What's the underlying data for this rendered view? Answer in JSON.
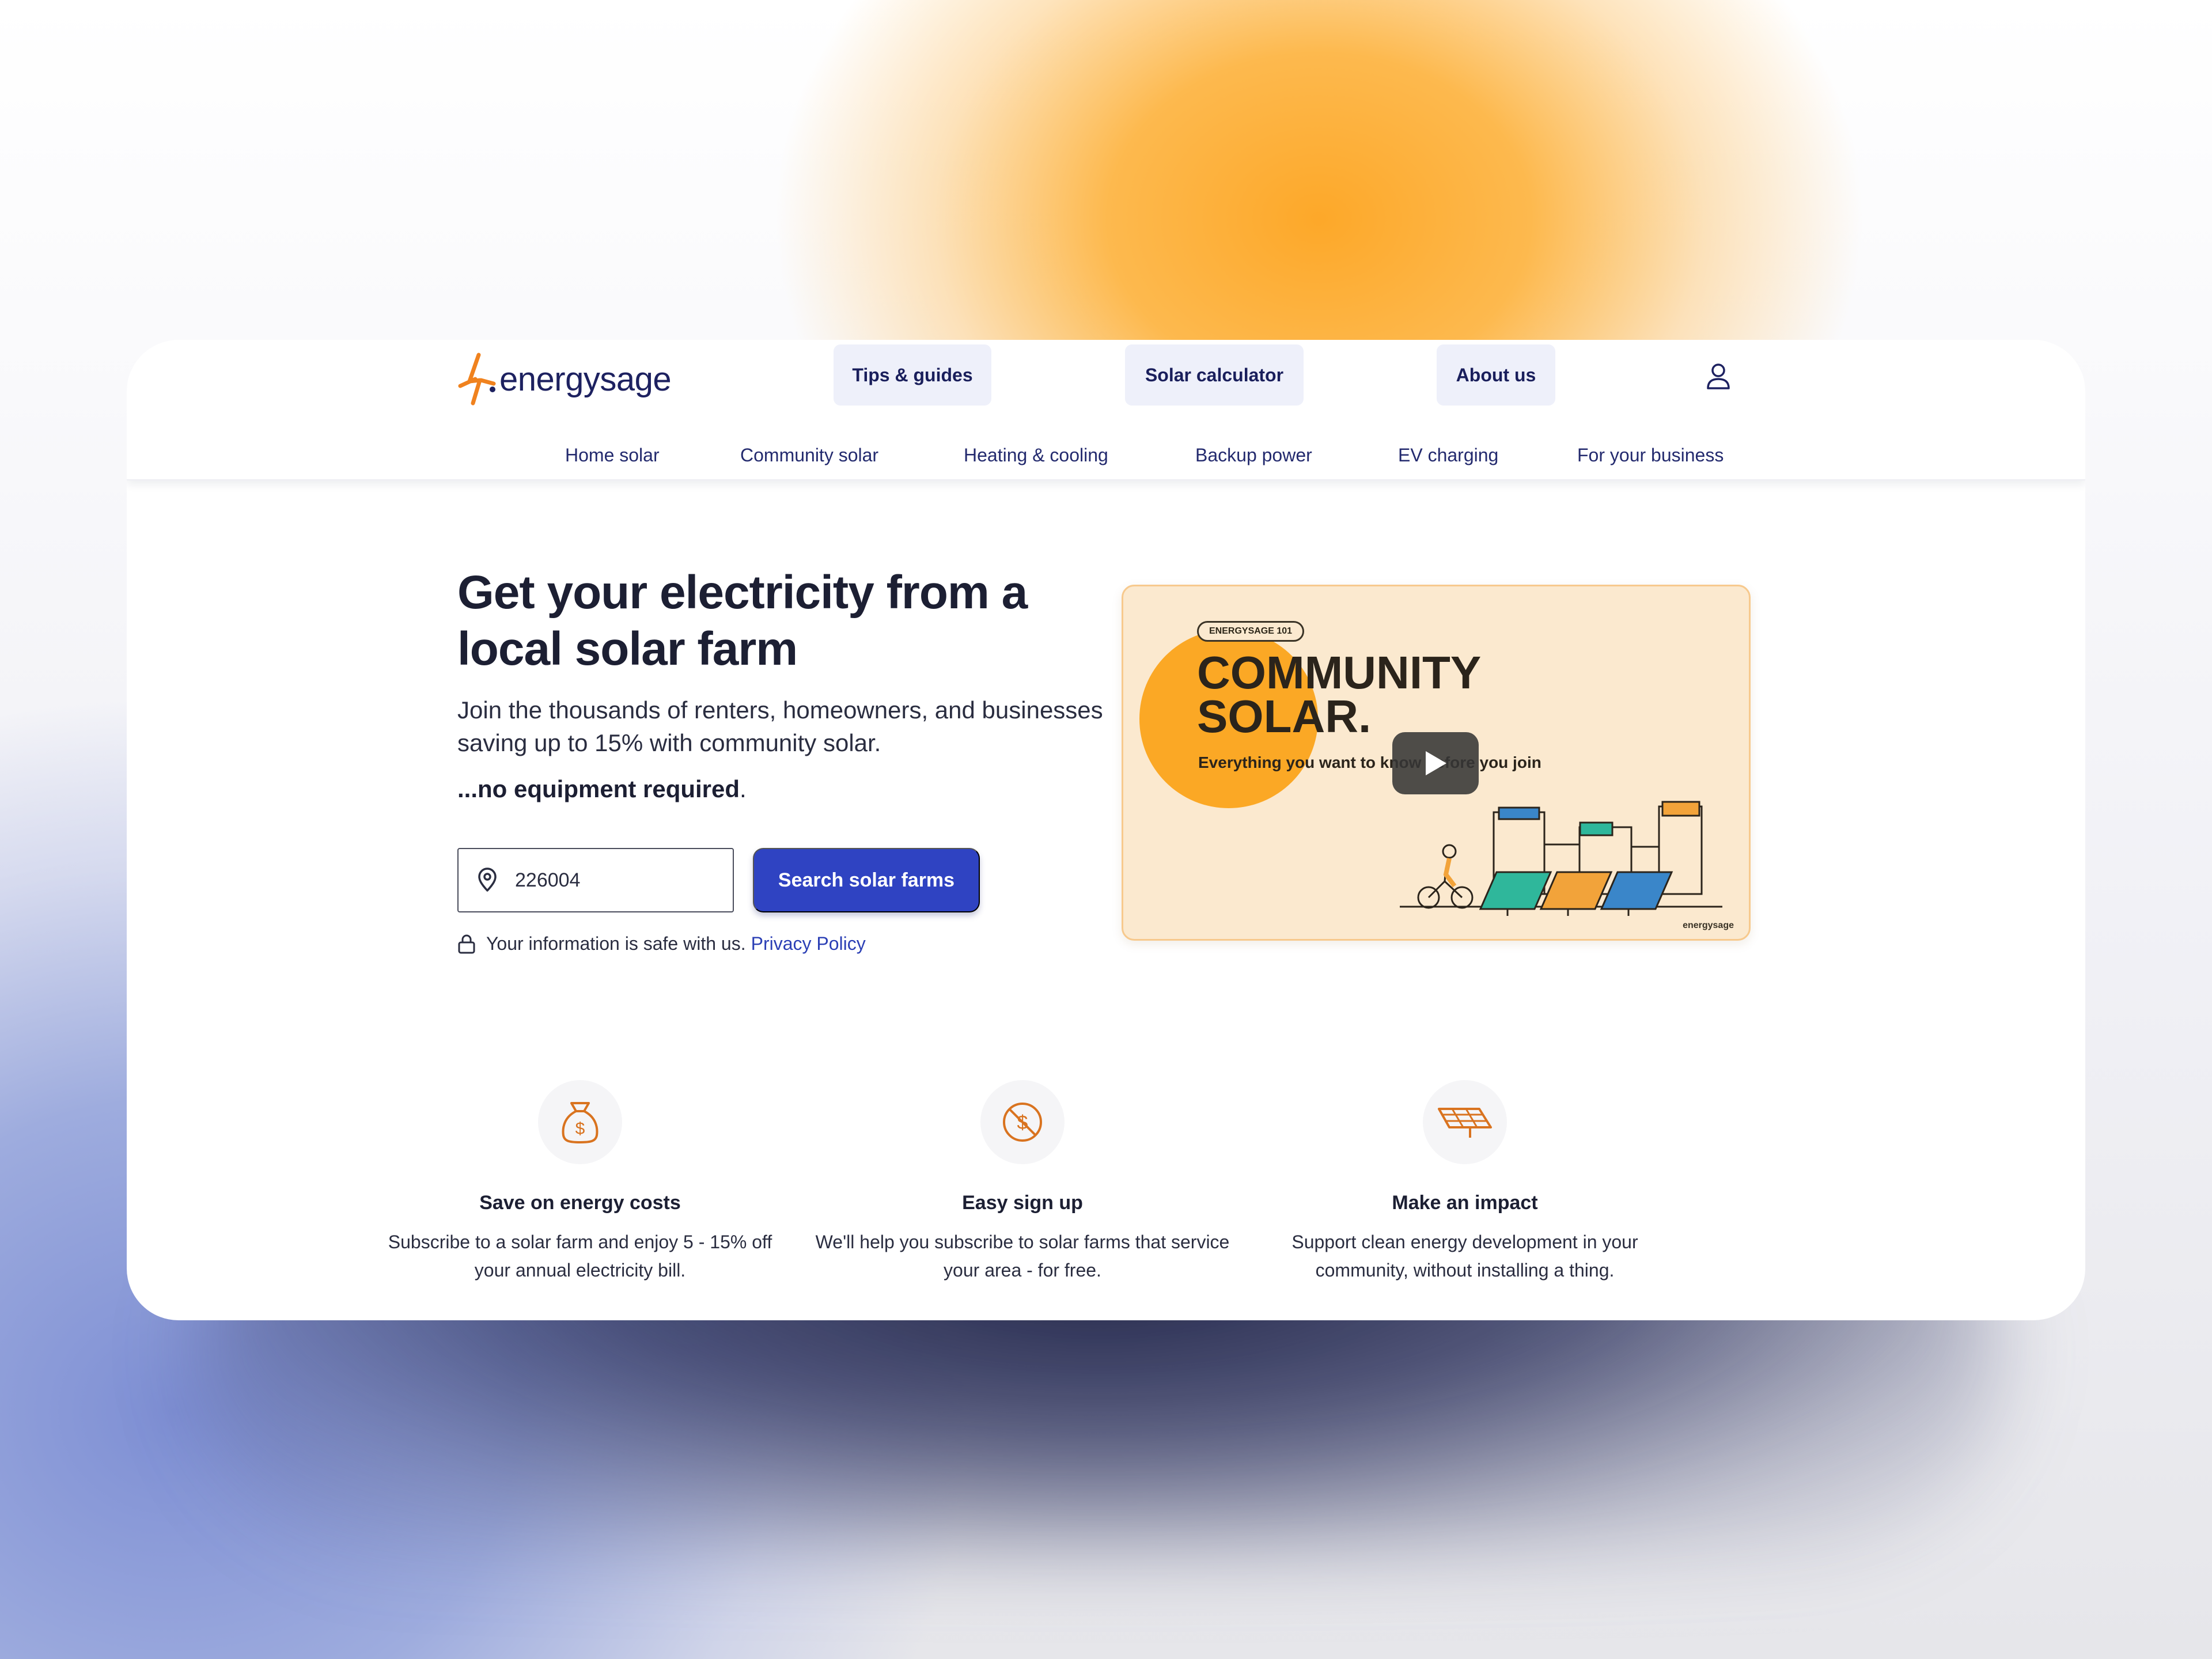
{
  "brand": {
    "name": "energysage",
    "accent": "#f0821e",
    "primary": "#2f43c2",
    "navy": "#1d2160"
  },
  "header": {
    "main_nav": [
      {
        "label": "Tips & guides"
      },
      {
        "label": "Solar calculator"
      },
      {
        "label": "About us"
      }
    ],
    "account_icon": "user-icon",
    "sub_nav": [
      {
        "label": "Home solar"
      },
      {
        "label": "Community solar"
      },
      {
        "label": "Heating & cooling"
      },
      {
        "label": "Backup power"
      },
      {
        "label": "EV charging"
      },
      {
        "label": "For your business"
      }
    ]
  },
  "hero": {
    "title": "Get your electricity from a local solar farm",
    "lead": "Join the thousands of renters, homeowners, and businesses saving up to 15% with community solar.",
    "note_bold": "...no equipment required",
    "note_end": ".",
    "zip_value": "226004",
    "search_label": "Search solar farms",
    "privacy_text": "Your information is safe with us.",
    "privacy_link": "Privacy Policy"
  },
  "video": {
    "badge": "ENERGYSAGE 101",
    "title_line1": "COMMUNITY",
    "title_line2": "SOLAR.",
    "subtitle": "Everything you want to know before you join",
    "brand": "energysage",
    "play_icon": "play-icon"
  },
  "features": [
    {
      "icon": "money-bag-icon",
      "title": "Save on energy costs",
      "text": "Subscribe to a solar farm and enjoy 5 - 15% off your annual electricity bill."
    },
    {
      "icon": "no-fee-icon",
      "title": "Easy sign up",
      "text": "We'll help you subscribe to solar farms that service your area - for free."
    },
    {
      "icon": "solar-panel-icon",
      "title": "Make an impact",
      "text": "Support clean energy development in your community, without installing a thing."
    }
  ]
}
